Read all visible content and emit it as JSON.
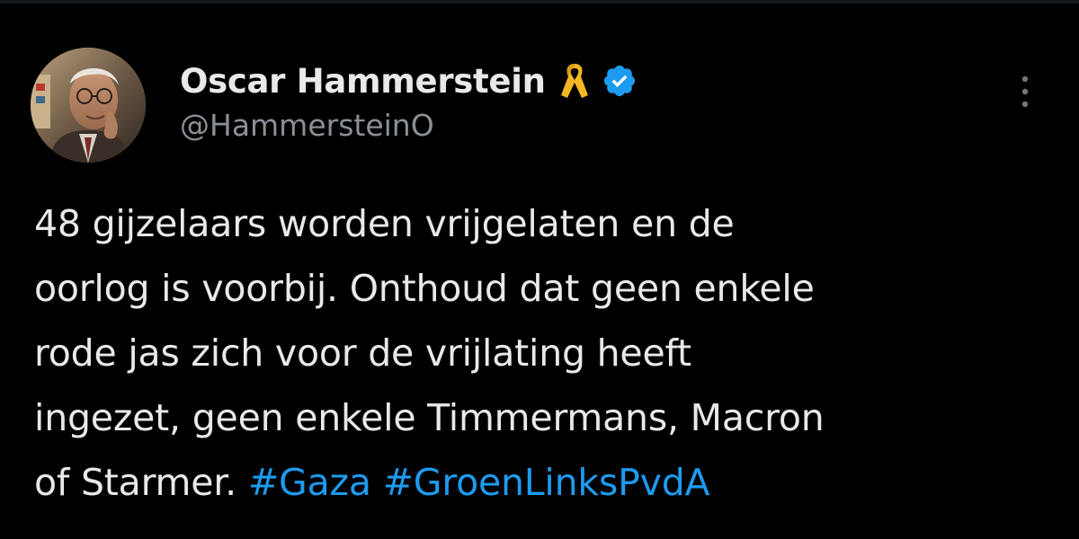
{
  "tweet": {
    "author": {
      "display_name": "Oscar Hammerstein",
      "handle": "@HammersteinO",
      "badges": [
        "yellow-ribbon-icon",
        "verified-badge-icon"
      ]
    },
    "more_icon": "vertical-ellipsis-icon",
    "text_lines": [
      "48 gijzelaars worden vrijgelaten en de",
      "oorlog is voorbij. Onthoud dat geen enkele",
      "rode jas zich voor de vrijlating heeft",
      "ingezet, geen enkele Timmermans, Macron",
      "of Starmer."
    ],
    "hashtags": [
      "#Gaza",
      "#GroenLinksPvdA"
    ]
  },
  "colors": {
    "background": "#000000",
    "text": "#e7e9ea",
    "secondary_text": "#8b9096",
    "link": "#1d9bf0",
    "verified": "#1d9bf0",
    "ribbon": "#f2b824"
  }
}
